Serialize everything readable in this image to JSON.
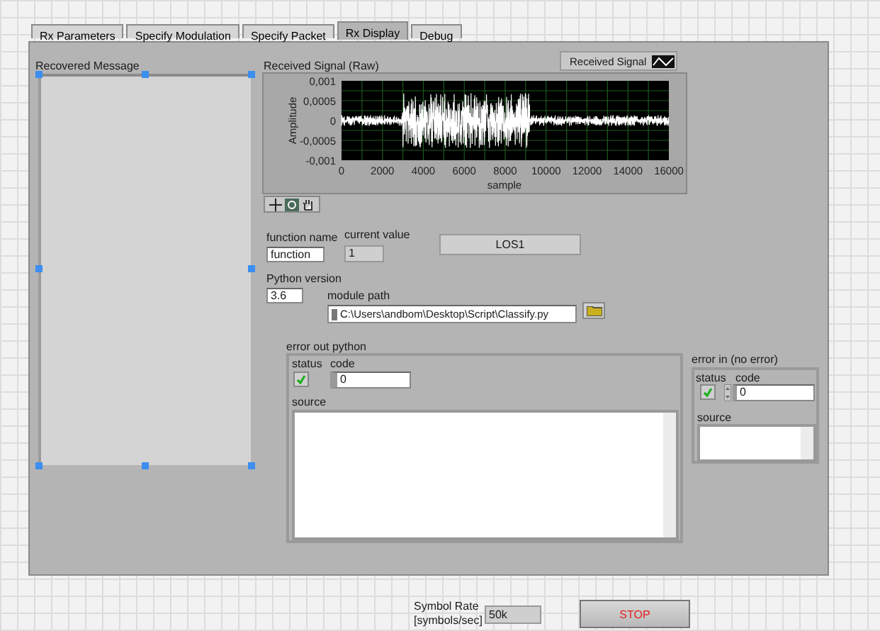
{
  "tabs": [
    {
      "label": "Rx Parameters",
      "selected": false
    },
    {
      "label": "Specify Modulation",
      "selected": false
    },
    {
      "label": "Specify Packet",
      "selected": false
    },
    {
      "label": "Rx Display",
      "selected": true
    },
    {
      "label": "Debug",
      "selected": false
    }
  ],
  "recovered_message": {
    "label": "Recovered Message"
  },
  "graph": {
    "title": "Received Signal (Raw)",
    "legend": "Received Signal",
    "ylabel": "Amplitude",
    "xlabel": "sample",
    "yticks": [
      "0,001",
      "0,0005",
      "0",
      "-0,0005",
      "-0,001"
    ],
    "xticks": [
      "0",
      "2000",
      "4000",
      "6000",
      "8000",
      "10000",
      "12000",
      "14000",
      "16000"
    ]
  },
  "function_name": {
    "label": "function name",
    "value": "function"
  },
  "current_value": {
    "label": "current value",
    "value": "1"
  },
  "result": {
    "value": "LOS1"
  },
  "python_version": {
    "label": "Python version",
    "value": "3.6"
  },
  "module_path": {
    "label": "module path",
    "value": "C:\\Users\\andbom\\Desktop\\Script\\Classify.py"
  },
  "error_out": {
    "label": "error out python",
    "status_label": "status",
    "status_ok": true,
    "code_label": "code",
    "code": "0",
    "source_label": "source"
  },
  "error_in": {
    "label": "error in (no error)",
    "status_label": "status",
    "status_ok": true,
    "code_label": "code",
    "code": "0",
    "source_label": "source"
  },
  "symbol_rate": {
    "label": "Symbol Rate [symbols/sec]",
    "value": "50k"
  },
  "stop_button": {
    "label": "STOP"
  }
}
